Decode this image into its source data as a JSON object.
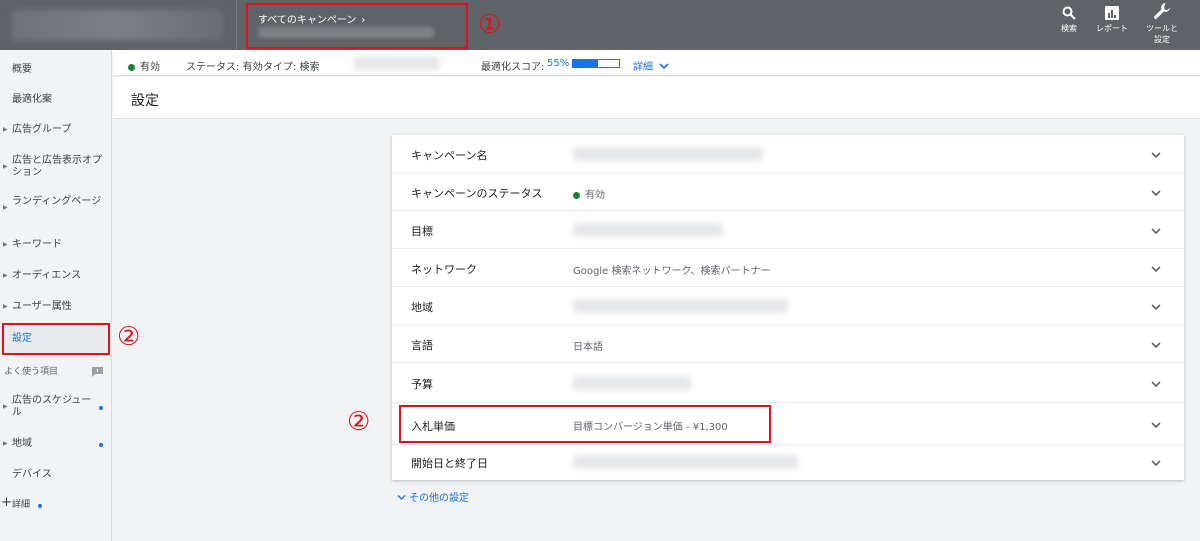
{
  "topbar": {
    "breadcrumb": "すべてのキャンペーン",
    "breadcrumb_chevron": "›",
    "tools": [
      {
        "icon": "search-icon",
        "label": "検索"
      },
      {
        "icon": "report-icon",
        "label": "レポート"
      },
      {
        "icon": "wrench-icon",
        "label": "ツールと\n設定"
      }
    ]
  },
  "annotations": {
    "marker1": "①",
    "marker2_sidebar": "②",
    "marker2_row": "②",
    "color": "#e0111b"
  },
  "sidebar": {
    "items": [
      {
        "label": "概要",
        "has_arrow": false
      },
      {
        "label": "最適化案",
        "has_arrow": false
      },
      {
        "label": "広告グループ",
        "has_arrow": true
      },
      {
        "label": "広告と広告表示オプション",
        "has_arrow": true
      },
      {
        "label": "ランディングページ",
        "has_arrow": true
      },
      {
        "label": "キーワード",
        "has_arrow": true
      },
      {
        "label": "オーディエンス",
        "has_arrow": true
      },
      {
        "label": "ユーザー属性",
        "has_arrow": true
      },
      {
        "label": "設定",
        "has_arrow": false,
        "active": true
      }
    ],
    "favorites_header": "よく使う項目",
    "favorites": [
      {
        "label": "広告のスケジュール",
        "has_arrow": true,
        "dot": true
      },
      {
        "label": "地域",
        "has_arrow": true,
        "dot": true
      },
      {
        "label": "デバイス",
        "has_arrow": false,
        "dot": false
      }
    ],
    "more_label": "詳細",
    "more_prefix": "+"
  },
  "status": {
    "enabled": "有効",
    "status_text": "ステータス: 有効",
    "type_text": "タイプ: 検索",
    "score_label": "最適化スコア:",
    "score_value": "55%",
    "score_fraction": 0.55,
    "details": "詳細",
    "accent": "#1a73e8"
  },
  "page": {
    "title": "設定"
  },
  "settings": {
    "rows": [
      {
        "label": "キャンペーン名",
        "value": "",
        "blurred": true
      },
      {
        "label": "キャンペーンのステータス",
        "value": "有効",
        "status_dot": true
      },
      {
        "label": "目標",
        "value": "",
        "blurred": true
      },
      {
        "label": "ネットワーク",
        "value": "Google 検索ネットワーク、検索パートナー"
      },
      {
        "label": "地域",
        "value": "",
        "blurred": true
      },
      {
        "label": "言語",
        "value": "日本語"
      },
      {
        "label": "予算",
        "value": "",
        "blurred": true
      },
      {
        "label": "入札単価",
        "value": "目標コンバージョン単価 - ¥1,300",
        "highlighted": true
      },
      {
        "label": "開始日と終了日",
        "value": "",
        "blurred": true
      }
    ],
    "more_settings": "その他の設定"
  }
}
